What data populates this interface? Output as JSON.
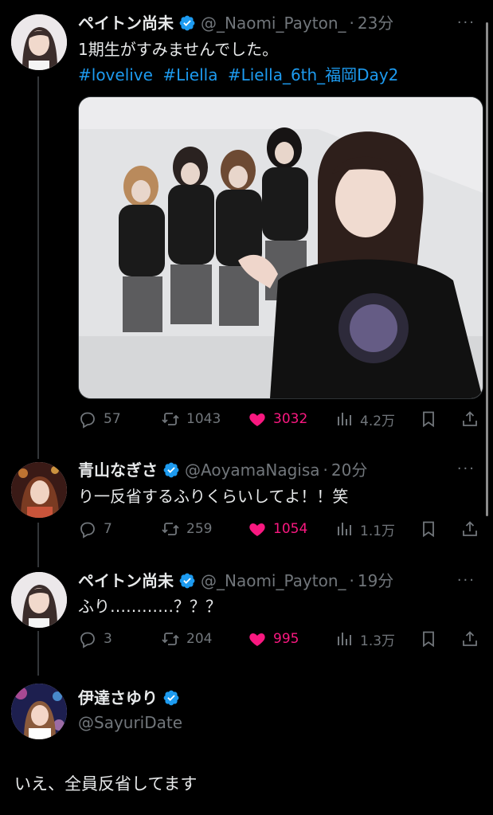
{
  "tweets": [
    {
      "name": "ペイトン尚未",
      "handle": "@_Naomi_Payton_",
      "time": "23分",
      "text": "1期生がすみませんでした。",
      "hashtags": [
        "#lovelive",
        "#Liella",
        "#Liella_6th_福岡Day2"
      ],
      "replies": "57",
      "retweets": "1043",
      "likes": "3032",
      "views": "4.2万"
    },
    {
      "name": "青山なぎさ",
      "handle": "@AoyamaNagisa",
      "time": "20分",
      "text": "り一反省するふりくらいしてよ！！笑",
      "replies": "7",
      "retweets": "259",
      "likes": "1054",
      "views": "1.1万"
    },
    {
      "name": "ペイトン尚未",
      "handle": "@_Naomi_Payton_",
      "time": "19分",
      "text": "ふり…………？？？",
      "replies": "3",
      "retweets": "204",
      "likes": "995",
      "views": "1.3万"
    }
  ],
  "main": {
    "name": "伊達さゆり",
    "handle": "@SayuriDate",
    "text": "いえ、全員反省してます"
  },
  "ui": {
    "dot": "·",
    "more": "···"
  },
  "colors": {
    "accent": "#1d9bf0",
    "like": "#f91880",
    "muted": "#71767b",
    "background": "#000000"
  },
  "icons": [
    "verified-badge-icon",
    "reply-icon",
    "retweet-icon",
    "heart-icon",
    "views-icon",
    "bookmark-icon",
    "share-icon",
    "more-icon"
  ]
}
